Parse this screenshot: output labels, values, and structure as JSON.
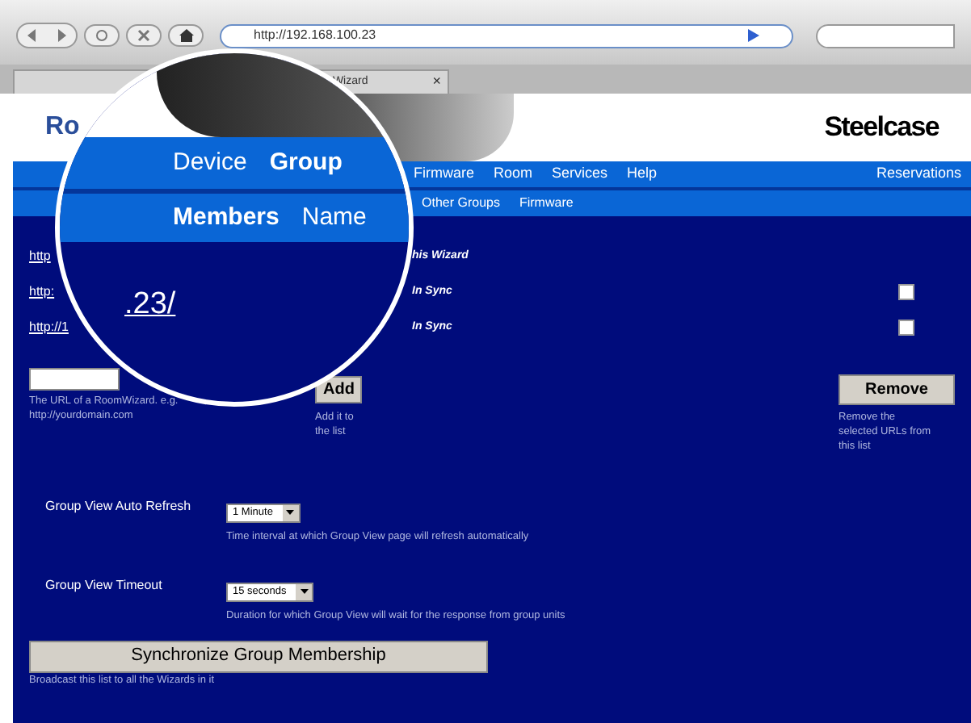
{
  "browser": {
    "url": "http://192.168.100.23",
    "tab_title": "Wizard",
    "tab_close": "×"
  },
  "header": {
    "title": "Ro",
    "logo": "Steelcase"
  },
  "nav": {
    "items": [
      {
        "label": "Firmware"
      },
      {
        "label": "Room"
      },
      {
        "label": "Services"
      },
      {
        "label": "Help"
      }
    ],
    "right": "Reservations"
  },
  "subnav": {
    "items": [
      {
        "label": "Other Groups"
      },
      {
        "label": "Firmware"
      }
    ]
  },
  "members": {
    "rows": [
      {
        "kind": "self",
        "url": "http",
        "status": "his Wizard"
      },
      {
        "kind": "member",
        "url": "http:",
        "status": "In Sync",
        "checked": false
      },
      {
        "kind": "member",
        "url": "http://1",
        "status": "In Sync",
        "checked": false
      }
    ]
  },
  "add": {
    "hint_lines": [
      "The URL of a RoomWizard. e.g.",
      "http://yourdomain.com"
    ],
    "button": "Add",
    "button_hint": [
      "Add it to",
      "the list"
    ]
  },
  "remove": {
    "button": "Remove",
    "hint": [
      "Remove the",
      "selected URLs from",
      "this list"
    ]
  },
  "settings": [
    {
      "label": "Group View Auto Refresh",
      "value": "1 Minute",
      "hint": "Time interval at which Group View page will refresh automatically"
    },
    {
      "label": "Group View Timeout",
      "value": "15 seconds",
      "hint": "Duration for which Group View will wait for the response from group units"
    }
  ],
  "sync": {
    "button": "Synchronize Group Membership",
    "hint": "Broadcast this list to all the Wizards in it"
  },
  "magnifier": {
    "nav": [
      {
        "label": "Device",
        "selected": false
      },
      {
        "label": "Group",
        "selected": true
      }
    ],
    "subnav": [
      {
        "label": "Members",
        "selected": true
      },
      {
        "label": "Name",
        "selected": false
      }
    ],
    "link": ".23/"
  }
}
